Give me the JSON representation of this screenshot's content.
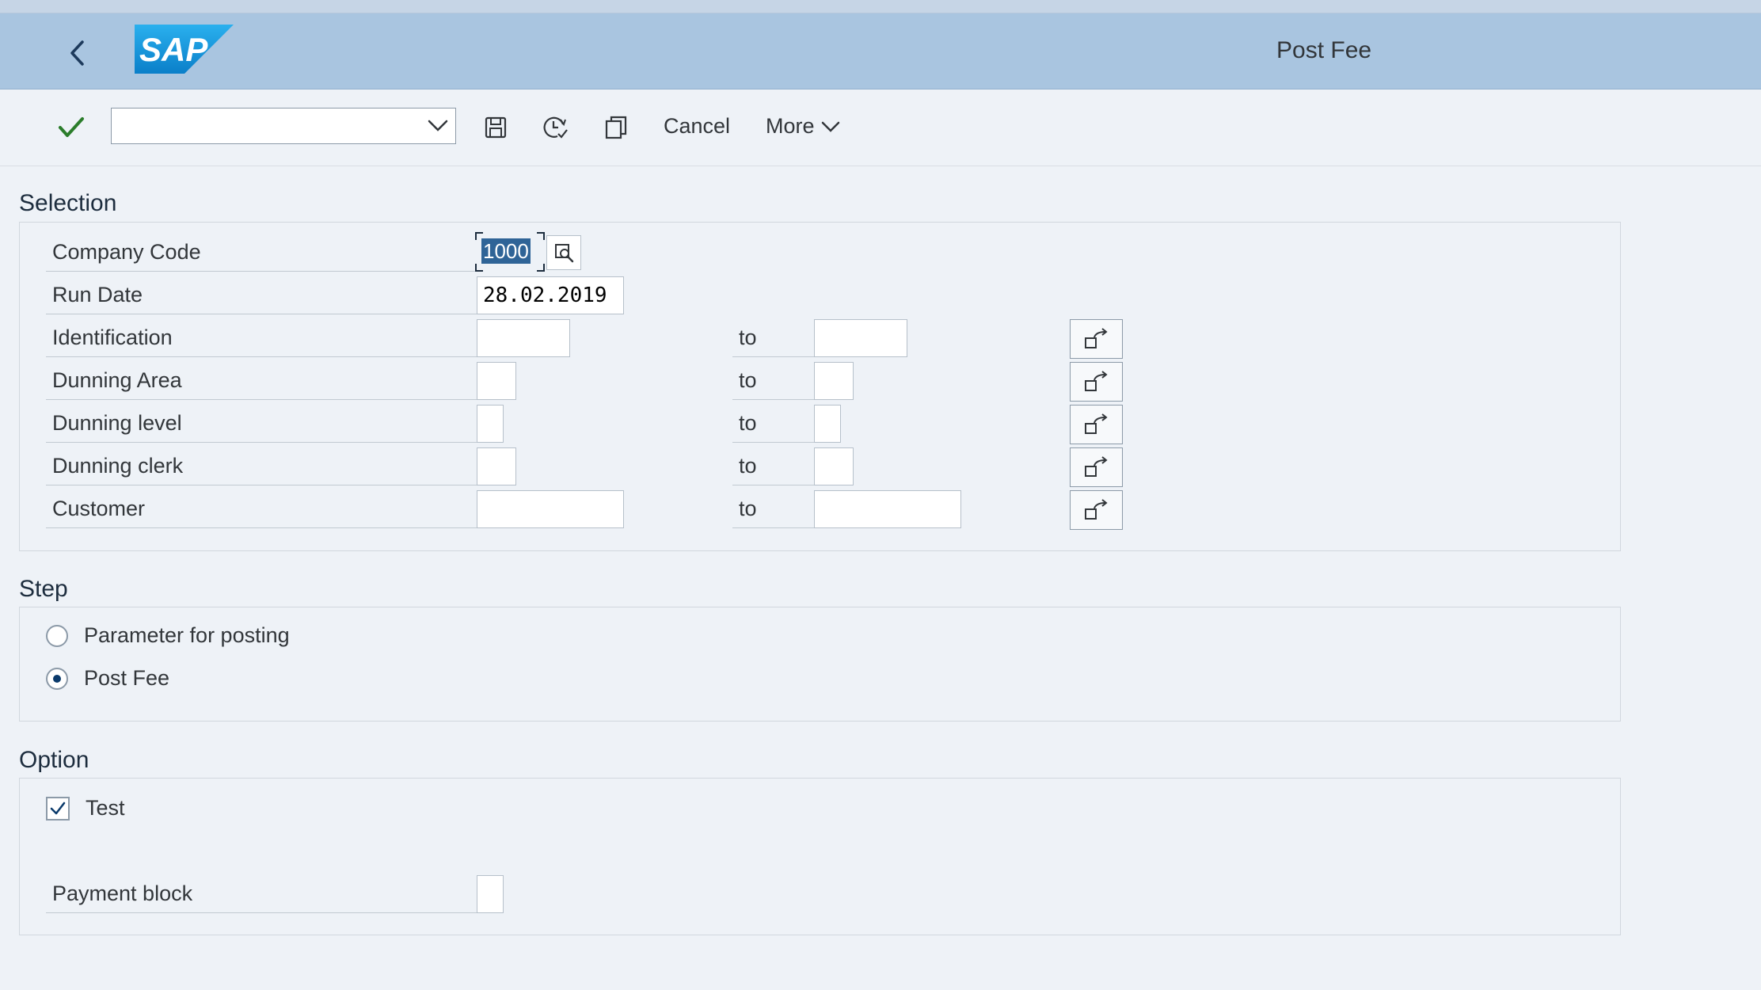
{
  "shell": {
    "title": "Post Fee",
    "logo_text": "SAP"
  },
  "toolbar": {
    "command_value": "",
    "cancel_label": "Cancel",
    "more_label": "More"
  },
  "selection": {
    "title": "Selection",
    "to_label": "to",
    "rows": [
      {
        "label": "Company Code",
        "value": "1000"
      },
      {
        "label": "Run Date",
        "value": "28.02.2019"
      },
      {
        "label": "Identification",
        "from": "",
        "to": ""
      },
      {
        "label": "Dunning Area",
        "from": "",
        "to": ""
      },
      {
        "label": "Dunning level",
        "from": "",
        "to": ""
      },
      {
        "label": "Dunning clerk",
        "from": "",
        "to": ""
      },
      {
        "label": "Customer",
        "from": "",
        "to": ""
      }
    ]
  },
  "step": {
    "title": "Step",
    "options": [
      {
        "label": "Parameter for posting",
        "selected": false
      },
      {
        "label": "Post Fee",
        "selected": true
      }
    ]
  },
  "option": {
    "title": "Option",
    "test_label": "Test",
    "test_checked": true,
    "payment_block_label": "Payment block",
    "payment_block_value": ""
  },
  "colors": {
    "shell_bar": "#a9c5e0",
    "check_green": "#2b7d2b",
    "selection_highlight": "#2f6497",
    "sap_blue": "#0a8fd6"
  }
}
